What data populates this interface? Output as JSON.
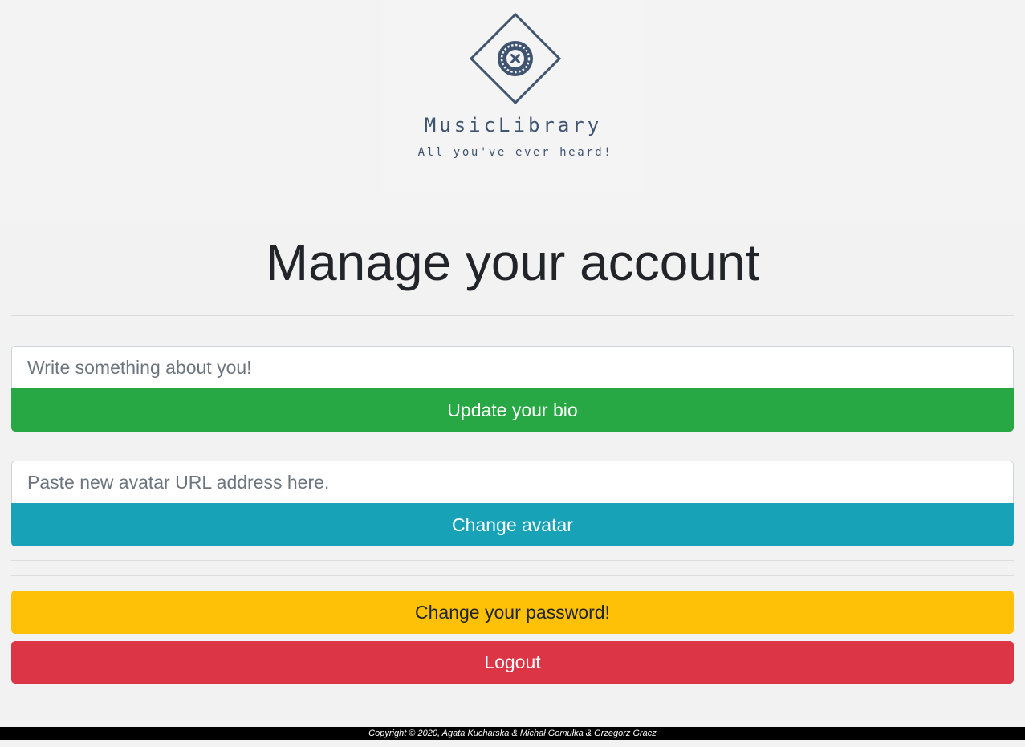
{
  "brand": {
    "name": "MusicLibrary",
    "tagline": "All you've ever heard!",
    "logo_icon": "vinyl-record-icon",
    "color": "#3e5470"
  },
  "page": {
    "title": "Manage your account"
  },
  "bio": {
    "placeholder": "Write something about you!",
    "value": "",
    "button_label": "Update your bio"
  },
  "avatar": {
    "placeholder": "Paste new avatar URL address here.",
    "value": "",
    "button_label": "Change avatar"
  },
  "password": {
    "button_label": "Change your password!"
  },
  "logout": {
    "button_label": "Logout"
  },
  "footer": {
    "copyright": "Copyright © 2020, Agata Kucharska & Michał Gomułka & Grzegorz Gracz"
  },
  "colors": {
    "success": "#28a745",
    "info": "#17a2b8",
    "warning": "#ffc107",
    "danger": "#dc3545",
    "footer_bg": "#000000"
  }
}
